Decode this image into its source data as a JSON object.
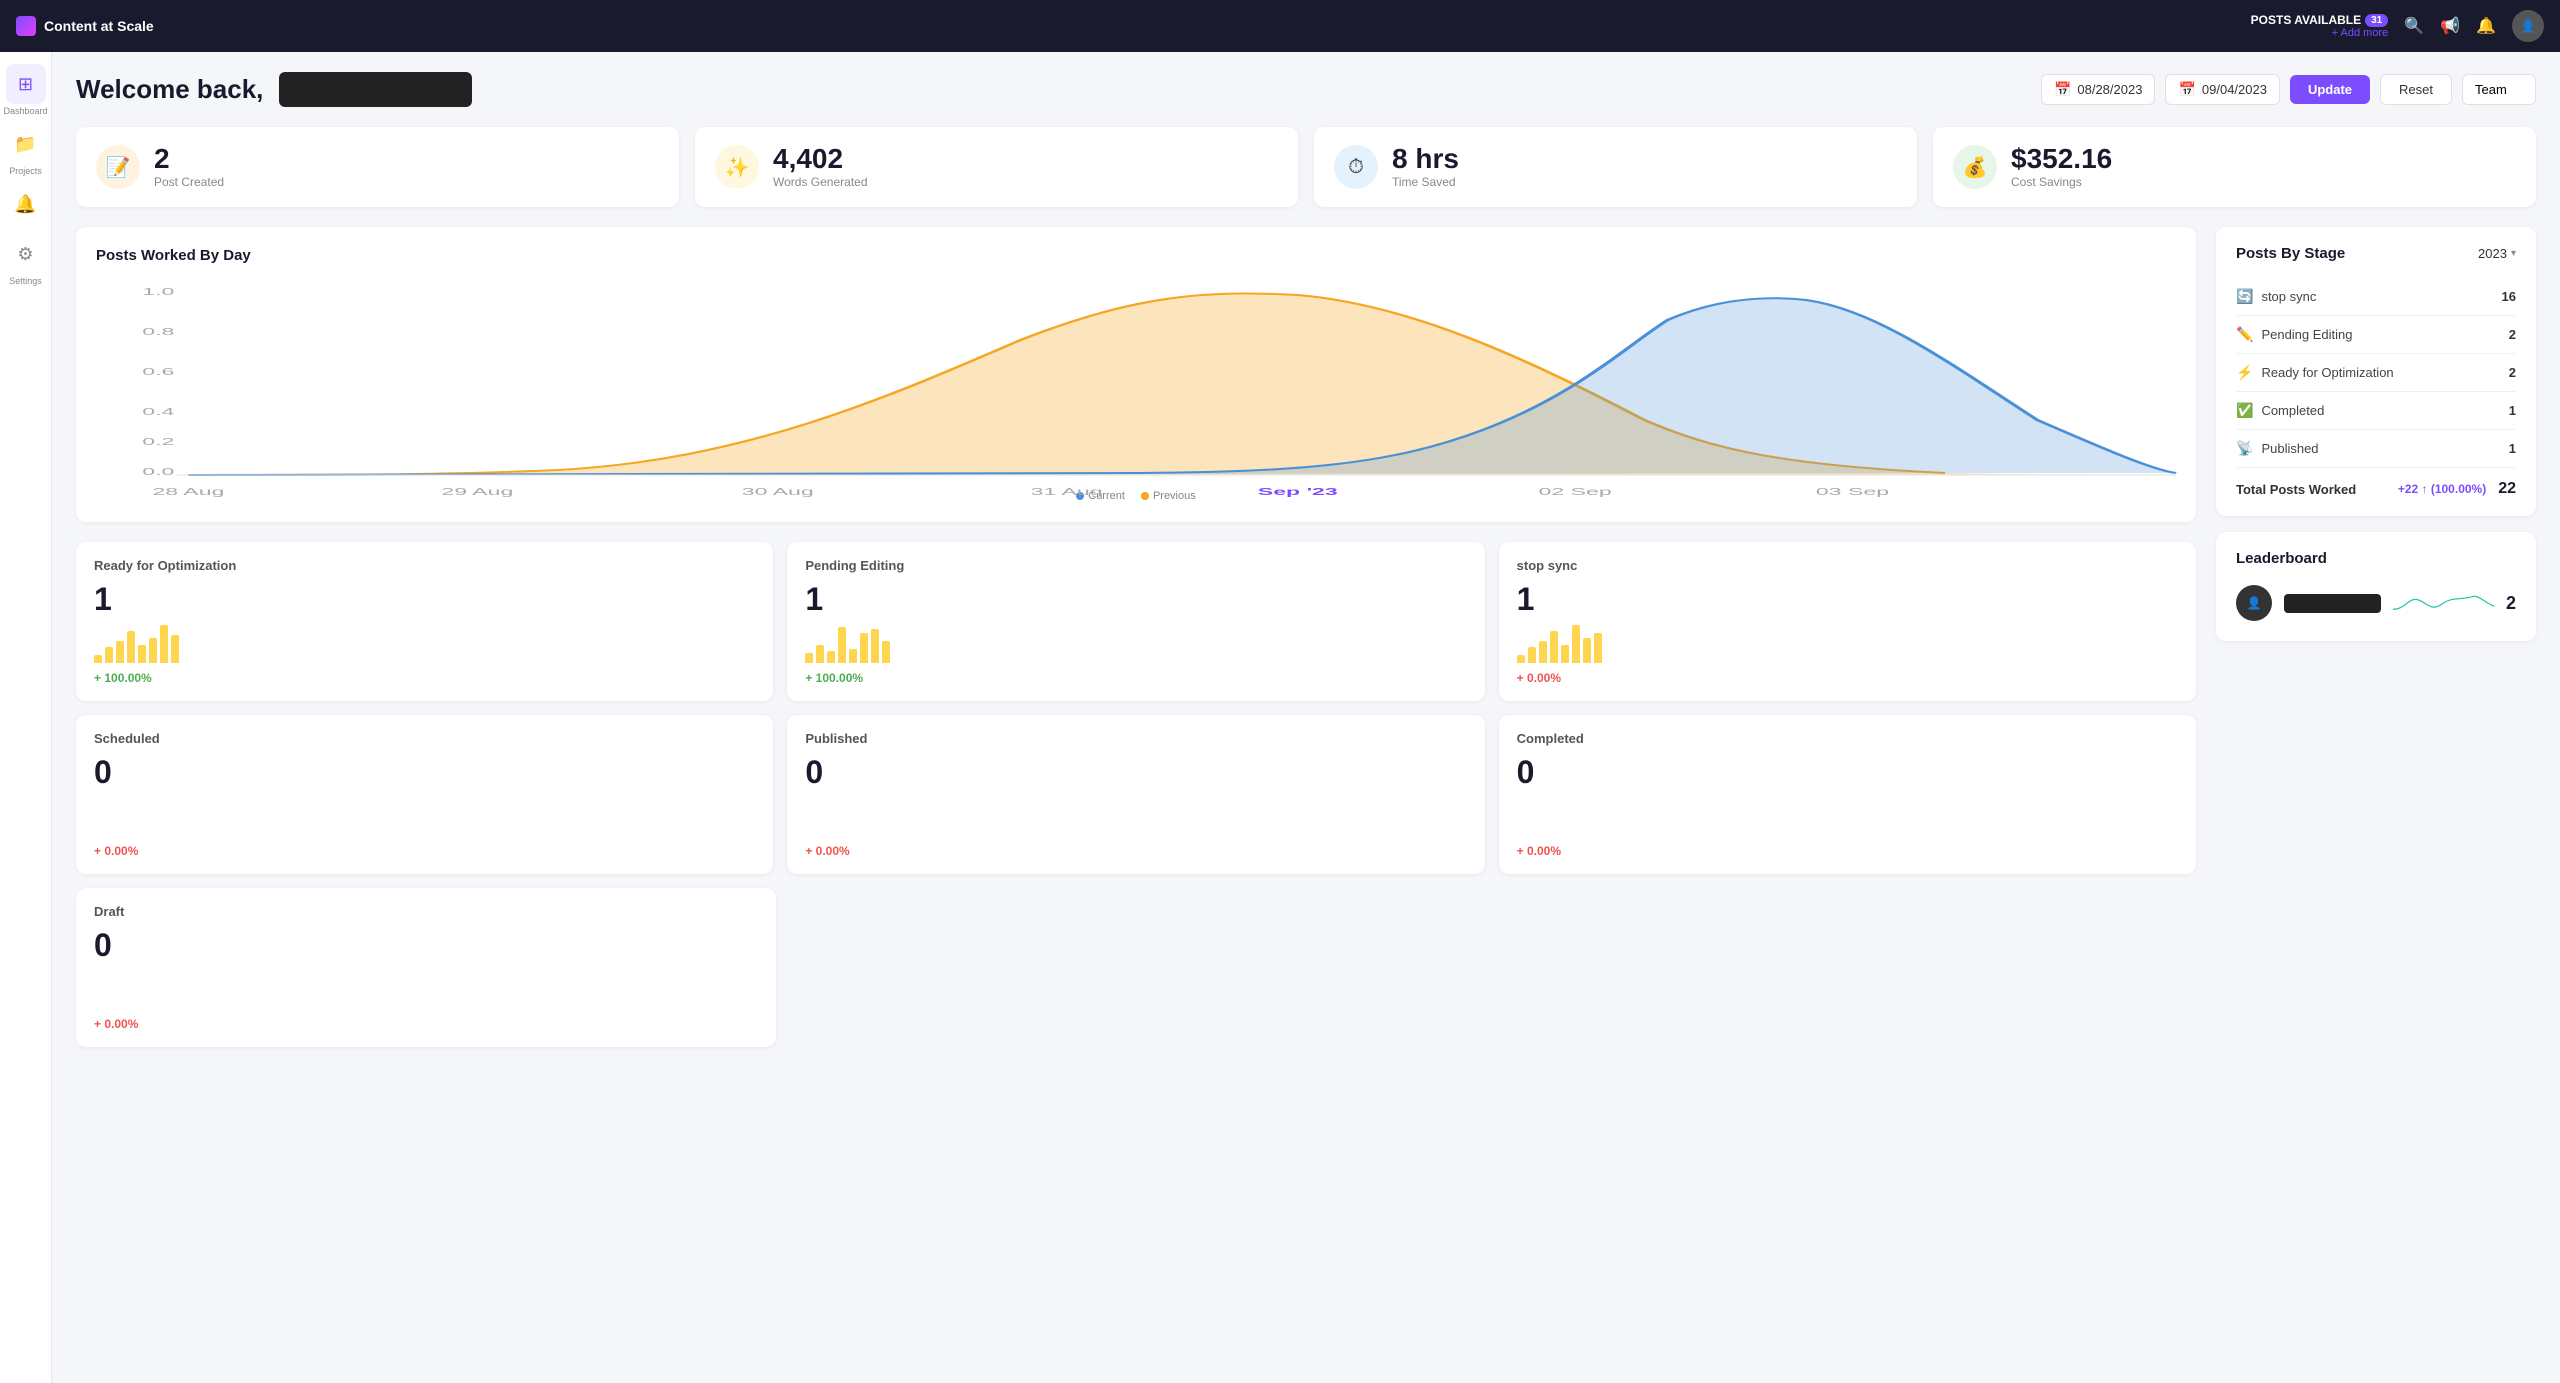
{
  "app": {
    "name": "Content at Scale"
  },
  "topNav": {
    "postsAvailableLabel": "POSTS AVAILABLE",
    "postsAvailableCount": "31",
    "addMoreLabel": "+ Add more",
    "icons": [
      "search",
      "megaphone",
      "bell",
      "avatar"
    ]
  },
  "sidebar": {
    "items": [
      {
        "label": "Dashboard",
        "icon": "⊞",
        "active": true
      },
      {
        "label": "Projects",
        "icon": "📁",
        "active": false
      },
      {
        "label": "Alerts",
        "icon": "🔔",
        "active": false
      },
      {
        "label": "Settings",
        "icon": "⚙",
        "active": false
      }
    ]
  },
  "header": {
    "welcomeText": "Welcome back,",
    "dateFrom": "08/28/2023",
    "dateTo": "09/04/2023",
    "updateLabel": "Update",
    "resetLabel": "Reset",
    "teamLabel": "Team"
  },
  "statsCards": [
    {
      "icon": "📝",
      "iconClass": "orange",
      "value": "2",
      "label": "Post Created"
    },
    {
      "icon": "✨",
      "iconClass": "amber",
      "value": "4,402",
      "label": "Words Generated"
    },
    {
      "icon": "⏱",
      "iconClass": "blue",
      "value": "8 hrs",
      "label": "Time Saved"
    },
    {
      "icon": "💰",
      "iconClass": "green",
      "value": "$352.16",
      "label": "Cost Savings"
    }
  ],
  "chart": {
    "title": "Posts Worked By Day",
    "xLabels": [
      "28 Aug",
      "29 Aug",
      "30 Aug",
      "31 Aug",
      "Sep '23",
      "02 Sep",
      "03 Sep"
    ],
    "legend": [
      {
        "label": "Current",
        "color": "#4a90d9"
      },
      {
        "label": "Previous",
        "color": "#f5a623"
      }
    ]
  },
  "miniCards": [
    {
      "title": "Ready for Optimization",
      "value": "1",
      "change": "+ 100.00%",
      "changeClass": "change-positive",
      "bars": [
        2,
        5,
        8,
        12,
        6,
        9,
        15,
        10
      ]
    },
    {
      "title": "Pending Editing",
      "value": "1",
      "change": "+ 100.00%",
      "changeClass": "change-positive",
      "bars": [
        3,
        6,
        4,
        14,
        5,
        11,
        13,
        8
      ]
    },
    {
      "title": "stop sync",
      "value": "1",
      "change": "+ 0.00%",
      "changeClass": "change-zero",
      "bars": [
        2,
        5,
        8,
        12,
        6,
        14,
        9,
        11
      ]
    },
    {
      "title": "Scheduled",
      "value": "0",
      "change": "+ 0.00%",
      "changeClass": "change-zero",
      "bars": []
    },
    {
      "title": "Published",
      "value": "0",
      "change": "+ 0.00%",
      "changeClass": "change-zero",
      "bars": []
    },
    {
      "title": "Completed",
      "value": "0",
      "change": "+ 0.00%",
      "changeClass": "change-zero",
      "bars": []
    },
    {
      "title": "Draft",
      "value": "0",
      "change": "+ 0.00%",
      "changeClass": "change-zero",
      "bars": []
    }
  ],
  "postsByStage": {
    "title": "Posts By Stage",
    "yearLabel": "2023",
    "stages": [
      {
        "icon": "🔄",
        "label": "stop sync",
        "count": "16"
      },
      {
        "icon": "✏️",
        "label": "Pending Editing",
        "count": "2"
      },
      {
        "icon": "⚡",
        "label": "Ready for Optimization",
        "count": "2"
      },
      {
        "icon": "✅",
        "label": "Completed",
        "count": "1"
      },
      {
        "icon": "📡",
        "label": "Published",
        "count": "1"
      }
    ],
    "totalLabel": "Total Posts Worked",
    "totalChange": "+22 ↑ (100.00%)",
    "totalCount": "22"
  },
  "leaderboard": {
    "title": "Leaderboard",
    "entries": [
      {
        "name": "████████",
        "count": "2"
      }
    ]
  }
}
